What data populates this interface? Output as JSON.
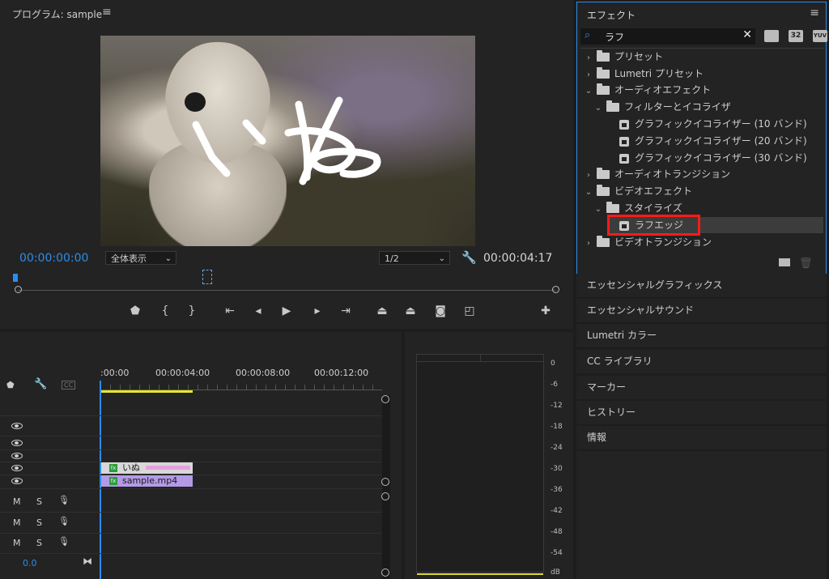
{
  "program": {
    "title": "プログラム: sample",
    "menu_icon": "hamburger-icon",
    "current_time": "00:00:00:00",
    "zoom": "全体表示",
    "resolution": "1/2",
    "duration": "00:00:04:17",
    "overlay_text": "いぬ",
    "transport": [
      "marker-icon",
      "mark-in-icon",
      "mark-out-icon",
      "go-to-in-icon",
      "step-back-icon",
      "play-icon",
      "step-forward-icon",
      "go-to-out-icon",
      "lift-icon",
      "extract-icon",
      "camera-icon",
      "comparison-icon",
      "add-icon"
    ]
  },
  "effects": {
    "title": "エフェクト",
    "search_value": "ラフ",
    "badges": [
      "32",
      "YUV"
    ],
    "tree": [
      {
        "label": "プリセット",
        "level": 0,
        "type": "folder-star",
        "open": false
      },
      {
        "label": "Lumetri プリセット",
        "level": 0,
        "type": "folder-star",
        "open": false
      },
      {
        "label": "オーディオエフェクト",
        "level": 0,
        "type": "folder",
        "open": true
      },
      {
        "label": "フィルターとイコライザ",
        "level": 1,
        "type": "folder",
        "open": true
      },
      {
        "label": "グラフィックイコライザー (10 バンド)",
        "level": 2,
        "type": "effect"
      },
      {
        "label": "グラフィックイコライザー (20 バンド)",
        "level": 2,
        "type": "effect"
      },
      {
        "label": "グラフィックイコライザー (30 バンド)",
        "level": 2,
        "type": "effect"
      },
      {
        "label": "オーディオトランジション",
        "level": 0,
        "type": "folder",
        "open": false
      },
      {
        "label": "ビデオエフェクト",
        "level": 0,
        "type": "folder",
        "open": true
      },
      {
        "label": "スタイライズ",
        "level": 1,
        "type": "folder",
        "open": true
      },
      {
        "label": "ラフエッジ",
        "level": 2,
        "type": "effect",
        "selected": true
      },
      {
        "label": "ビデオトランジション",
        "level": 0,
        "type": "folder",
        "open": false
      }
    ]
  },
  "collapsed_panels": [
    "エッセンシャルグラフィックス",
    "エッセンシャルサウンド",
    "Lumetri カラー",
    "CC ライブラリ",
    "マーカー",
    "ヒストリー",
    "情報"
  ],
  "timeline": {
    "ruler": [
      ":00:00",
      "00:00:04:00",
      "00:00:08:00",
      "00:00:12:00"
    ],
    "clips": [
      {
        "label": "いぬ",
        "color": "#e6a0e0"
      },
      {
        "label": "sample.mp4",
        "color": "#b49ae6"
      }
    ],
    "audio_buttons": [
      "M",
      "S"
    ],
    "volume": "0.0",
    "cc_label": "CC"
  },
  "meters": {
    "db_labels": [
      "0",
      "-6",
      "-12",
      "-18",
      "-24",
      "-30",
      "-36",
      "-42",
      "-48",
      "-54",
      "dB"
    ]
  },
  "colors": {
    "accent": "#2d8ceb",
    "highlight": "#ff1a1a",
    "playhead": "#2d8ceb",
    "work_area": "#e6e62a"
  }
}
